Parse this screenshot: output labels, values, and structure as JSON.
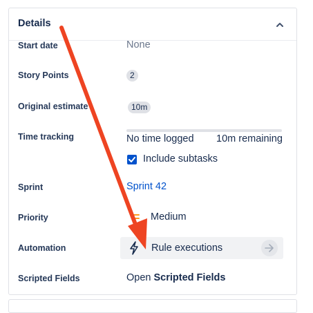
{
  "details": {
    "title": "Details",
    "collapse_icon": "chevron-up-icon",
    "fields": {
      "start_date": {
        "label": "Start date",
        "value": "None"
      },
      "story_points": {
        "label": "Story Points",
        "value": "2"
      },
      "original_estimate": {
        "label": "Original estimate",
        "value": "10m"
      },
      "time_tracking": {
        "label": "Time tracking",
        "logged": "No time logged",
        "remaining": "10m remaining",
        "progress_fraction": 0,
        "include_subtasks_label": "Include subtasks",
        "include_subtasks_checked": true
      },
      "sprint": {
        "label": "Sprint",
        "value": "Sprint 42"
      },
      "priority": {
        "label": "Priority",
        "value": "Medium",
        "icon": "priority-medium-icon",
        "color": "#ff991f"
      },
      "automation": {
        "label": "Automation",
        "button_label": "Rule executions",
        "icon": "lightning-bolt-icon"
      },
      "scripted_fields": {
        "label": "Scripted Fields",
        "prefix": "Open",
        "link": "Scripted Fields"
      }
    }
  },
  "annotation": {
    "arrow_color": "#ee4422"
  }
}
